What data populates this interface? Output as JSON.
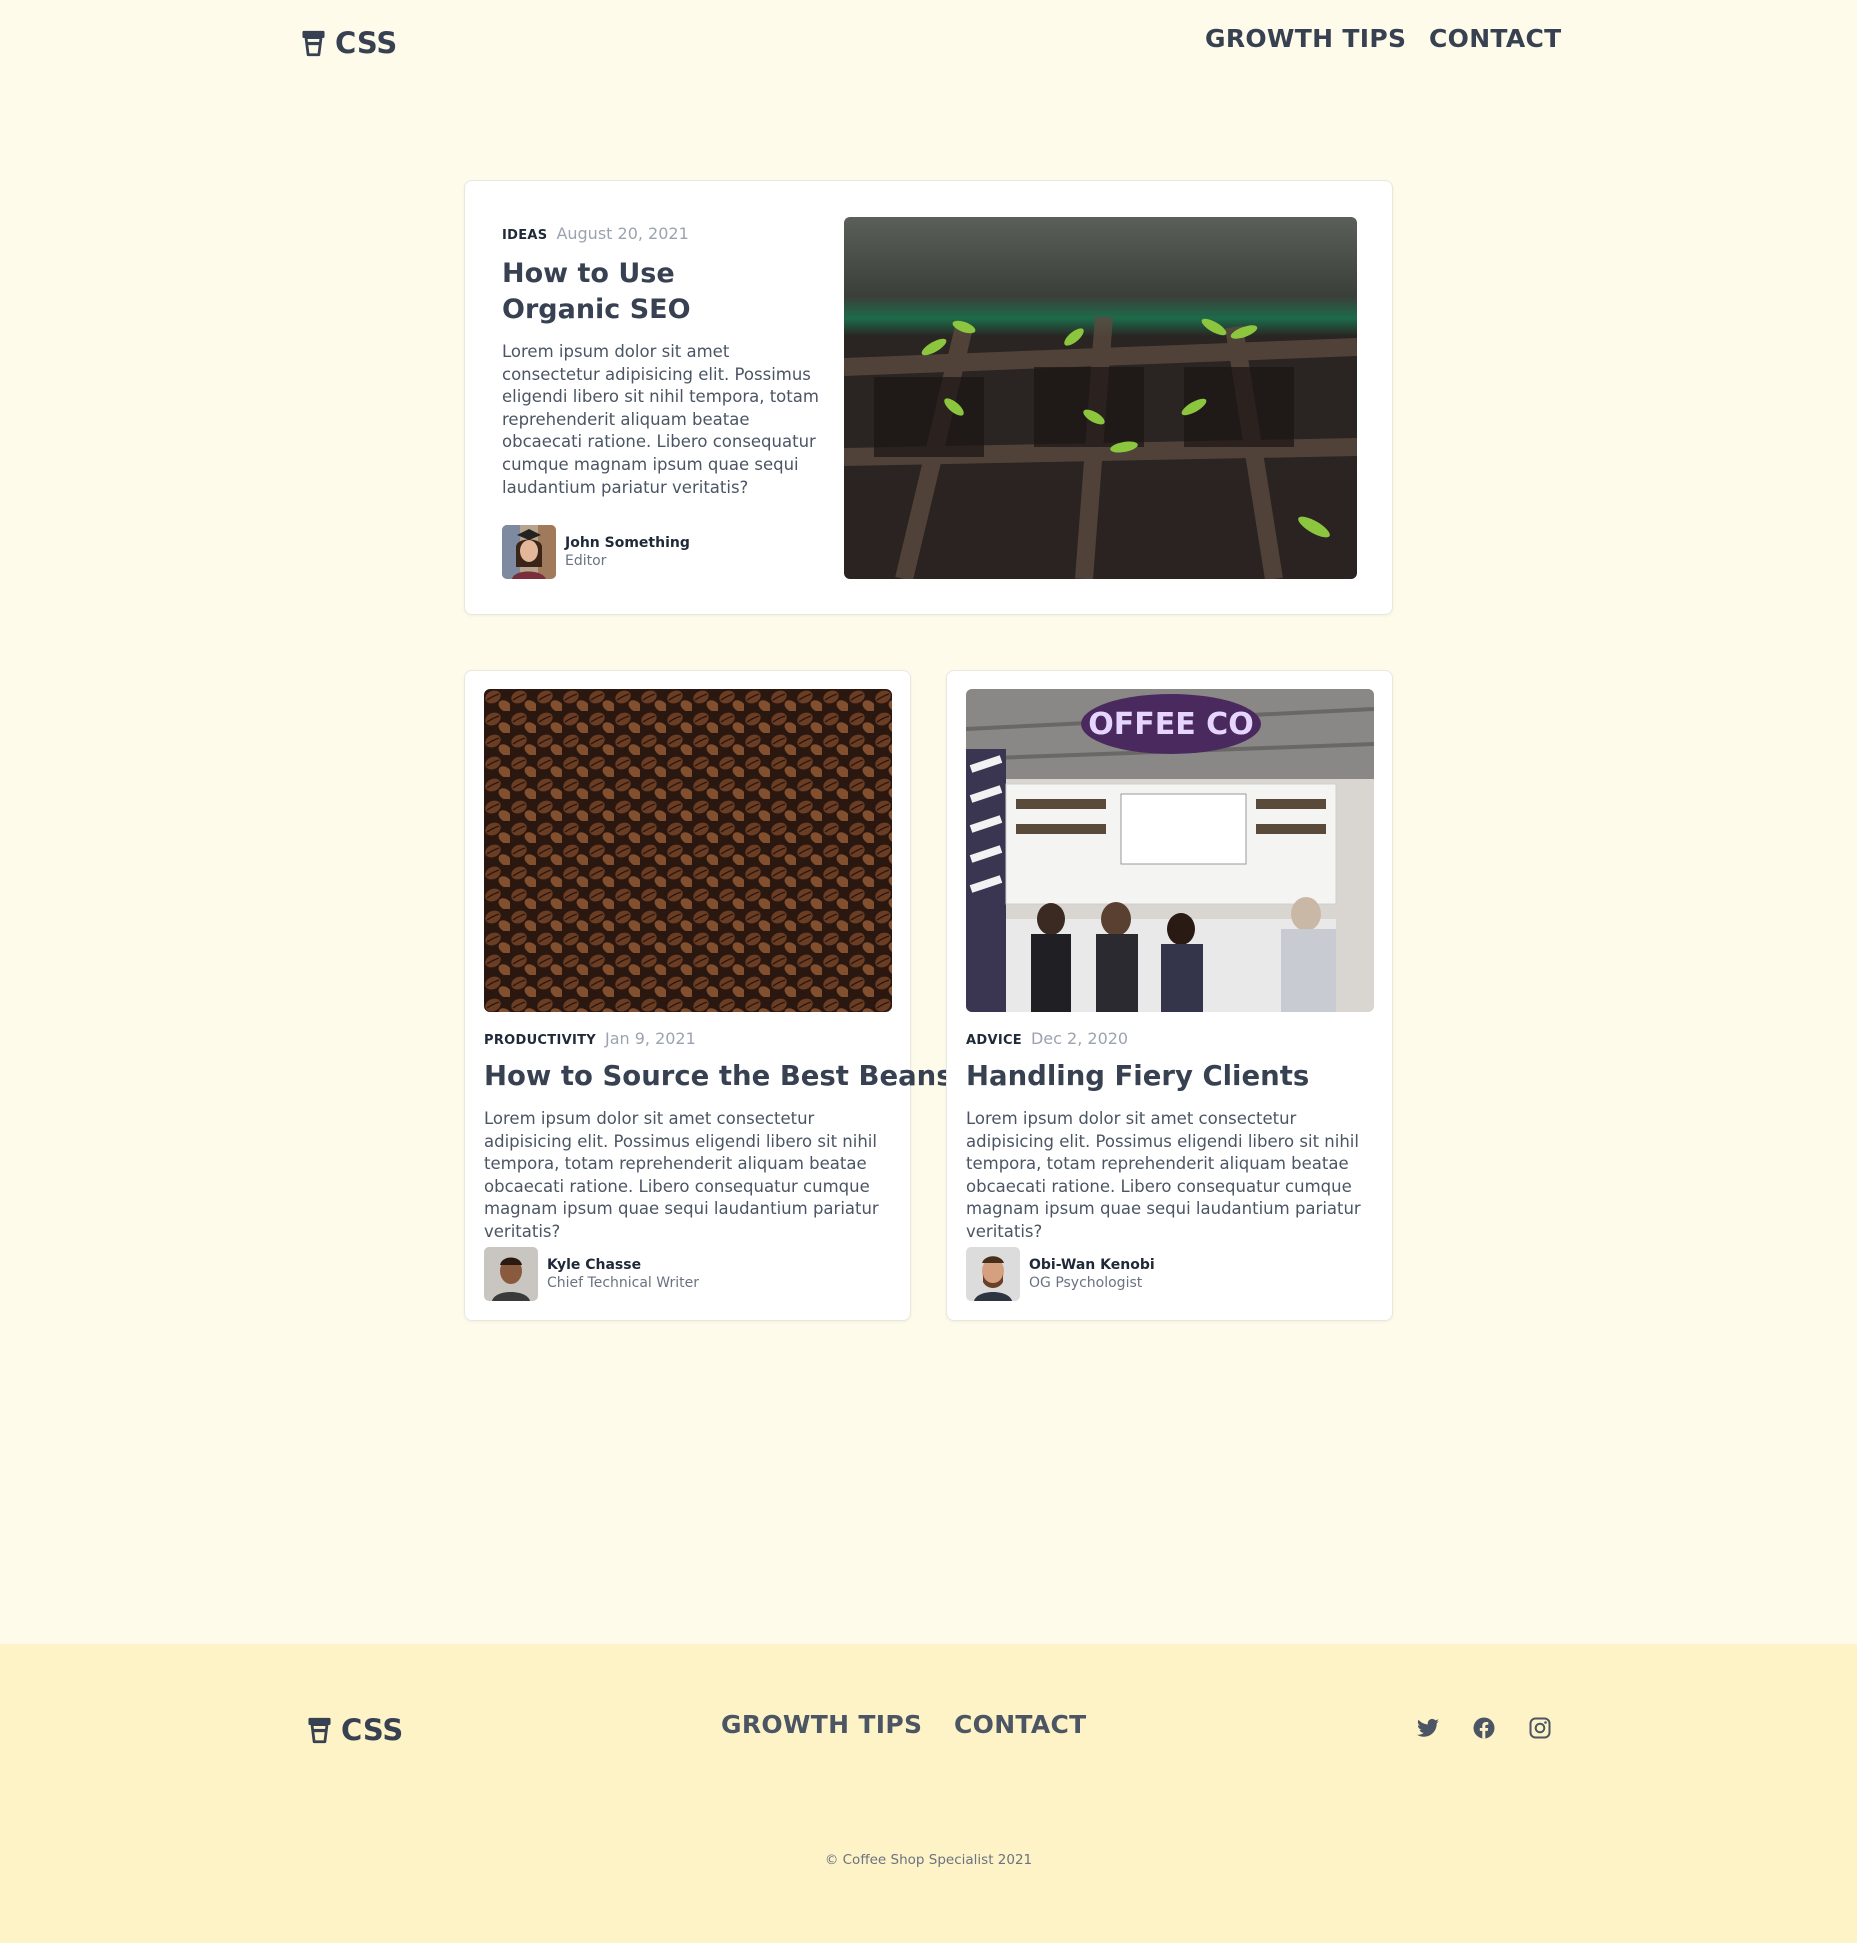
{
  "brand": {
    "name": "CSS",
    "icon": "coffee-cup-icon"
  },
  "nav": {
    "growth_tips": "GROWTH TIPS",
    "contact": "CONTACT"
  },
  "featured": {
    "tag": "Ideas",
    "date": "August 20, 2021",
    "title": "How to Use Organic SEO",
    "excerpt": "Lorem ipsum dolor sit amet consectetur adipisicing elit. Possimus eligendi libero sit nihil tempora, totam reprehenderit aliquam beatae obcaecati ratione. Libero consequatur cumque magnam ipsum quae sequi laudantium pariatur veritatis?",
    "author": {
      "name": "John Something",
      "role": "Editor"
    }
  },
  "posts": [
    {
      "tag": "Productivity",
      "date": "Jan 9, 2021",
      "title": "How to Source the Best Beans",
      "excerpt": "Lorem ipsum dolor sit amet consectetur adipisicing elit. Possimus eligendi libero sit nihil tempora, totam reprehenderit aliquam beatae obcaecati ratione. Libero consequatur cumque magnam ipsum quae sequi laudantium pariatur veritatis?",
      "author": {
        "name": "Kyle Chasse",
        "role": "Chief Technical Writer"
      }
    },
    {
      "tag": "Advice",
      "date": "Dec 2, 2020",
      "title": "Handling Fiery Clients",
      "excerpt": "Lorem ipsum dolor sit amet consectetur adipisicing elit. Possimus eligendi libero sit nihil tempora, totam reprehenderit aliquam beatae obcaecati ratione. Libero consequatur cumque magnam ipsum quae sequi laudantium pariatur veritatis?",
      "author": {
        "name": "Obi-Wan Kenobi",
        "role": "OG Psychologist"
      }
    }
  ],
  "footer": {
    "social": [
      "twitter-icon",
      "facebook-icon",
      "instagram-icon"
    ],
    "copyright": "© Coffee Shop Specialist 2021"
  },
  "colors": {
    "background": "#fefbea",
    "footer_bg": "#fef3c7",
    "text": "#374151"
  }
}
